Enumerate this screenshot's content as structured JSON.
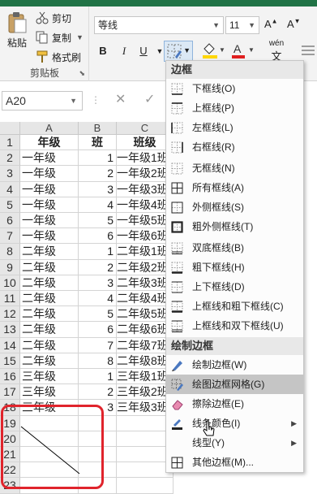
{
  "ribbon": {
    "clipboard": {
      "paste_label": "粘贴",
      "cut_label": "剪切",
      "copy_label": "复制",
      "format_painter_label": "格式刷",
      "group_label": "剪贴板"
    },
    "font": {
      "font_name": "等线",
      "font_size": "11",
      "bold": "B",
      "italic": "I",
      "underline": "U",
      "wen_label": "wén"
    }
  },
  "formula_bar": {
    "name_box": "A20",
    "cancel": "✕",
    "confirm": "✓"
  },
  "grid": {
    "columns": [
      "A",
      "B",
      "C"
    ],
    "header": {
      "row": "1",
      "a": "年级",
      "b": "班",
      "c": "班级"
    },
    "rows": [
      {
        "row": "2",
        "a": "一年级",
        "b": "1",
        "c": "一年级1班"
      },
      {
        "row": "3",
        "a": "一年级",
        "b": "2",
        "c": "一年级2班"
      },
      {
        "row": "4",
        "a": "一年级",
        "b": "3",
        "c": "一年级3班"
      },
      {
        "row": "5",
        "a": "一年级",
        "b": "4",
        "c": "一年级4班"
      },
      {
        "row": "6",
        "a": "一年级",
        "b": "5",
        "c": "一年级5班"
      },
      {
        "row": "7",
        "a": "一年级",
        "b": "6",
        "c": "一年级6班"
      },
      {
        "row": "8",
        "a": "二年级",
        "b": "1",
        "c": "二年级1班"
      },
      {
        "row": "9",
        "a": "二年级",
        "b": "2",
        "c": "二年级2班"
      },
      {
        "row": "10",
        "a": "二年级",
        "b": "3",
        "c": "二年级3班"
      },
      {
        "row": "11",
        "a": "二年级",
        "b": "4",
        "c": "二年级4班"
      },
      {
        "row": "12",
        "a": "二年级",
        "b": "5",
        "c": "二年级5班"
      },
      {
        "row": "13",
        "a": "二年级",
        "b": "6",
        "c": "二年级6班"
      },
      {
        "row": "14",
        "a": "二年级",
        "b": "7",
        "c": "二年级7班"
      },
      {
        "row": "15",
        "a": "二年级",
        "b": "8",
        "c": "二年级8班"
      },
      {
        "row": "16",
        "a": "三年级",
        "b": "1",
        "c": "三年级1班"
      },
      {
        "row": "17",
        "a": "三年级",
        "b": "2",
        "c": "三年级2班"
      },
      {
        "row": "18",
        "a": "三年级",
        "b": "3",
        "c": "三年级3班"
      }
    ],
    "empty_rows": [
      "19",
      "20",
      "21",
      "22",
      "23"
    ]
  },
  "border_menu": {
    "section1_title": "边框",
    "items1": [
      {
        "label": "下框线(O)",
        "icon": "bottom-border-icon"
      },
      {
        "label": "上框线(P)",
        "icon": "top-border-icon"
      },
      {
        "label": "左框线(L)",
        "icon": "left-border-icon"
      },
      {
        "label": "右框线(R)",
        "icon": "right-border-icon"
      },
      {
        "label": "无框线(N)",
        "icon": "no-border-icon"
      },
      {
        "label": "所有框线(A)",
        "icon": "all-borders-icon"
      },
      {
        "label": "外侧框线(S)",
        "icon": "outside-borders-icon"
      },
      {
        "label": "粗外侧框线(T)",
        "icon": "thick-outside-borders-icon"
      },
      {
        "label": "双底框线(B)",
        "icon": "double-bottom-border-icon"
      },
      {
        "label": "粗下框线(H)",
        "icon": "thick-bottom-border-icon"
      },
      {
        "label": "上下框线(D)",
        "icon": "top-bottom-border-icon"
      },
      {
        "label": "上框线和粗下框线(C)",
        "icon": "top-thick-bottom-border-icon"
      },
      {
        "label": "上框线和双下框线(U)",
        "icon": "top-double-bottom-border-icon"
      }
    ],
    "section2_title": "绘制边框",
    "items2": [
      {
        "label": "绘制边框(W)",
        "icon": "draw-border-icon"
      },
      {
        "label": "绘图边框网格(G)",
        "icon": "draw-border-grid-icon"
      },
      {
        "label": "擦除边框(E)",
        "icon": "eraser-icon"
      },
      {
        "label": "线条颜色(I)",
        "icon": "line-color-icon"
      },
      {
        "label": "线型(Y)",
        "icon": "line-style-icon"
      },
      {
        "label": "其他边框(M)...",
        "icon": "more-borders-icon"
      }
    ]
  },
  "colors": {
    "accent_green": "#217346",
    "highlight_red": "#e0242c",
    "fill_yellow": "#ffd700",
    "font_red": "#e02020"
  }
}
